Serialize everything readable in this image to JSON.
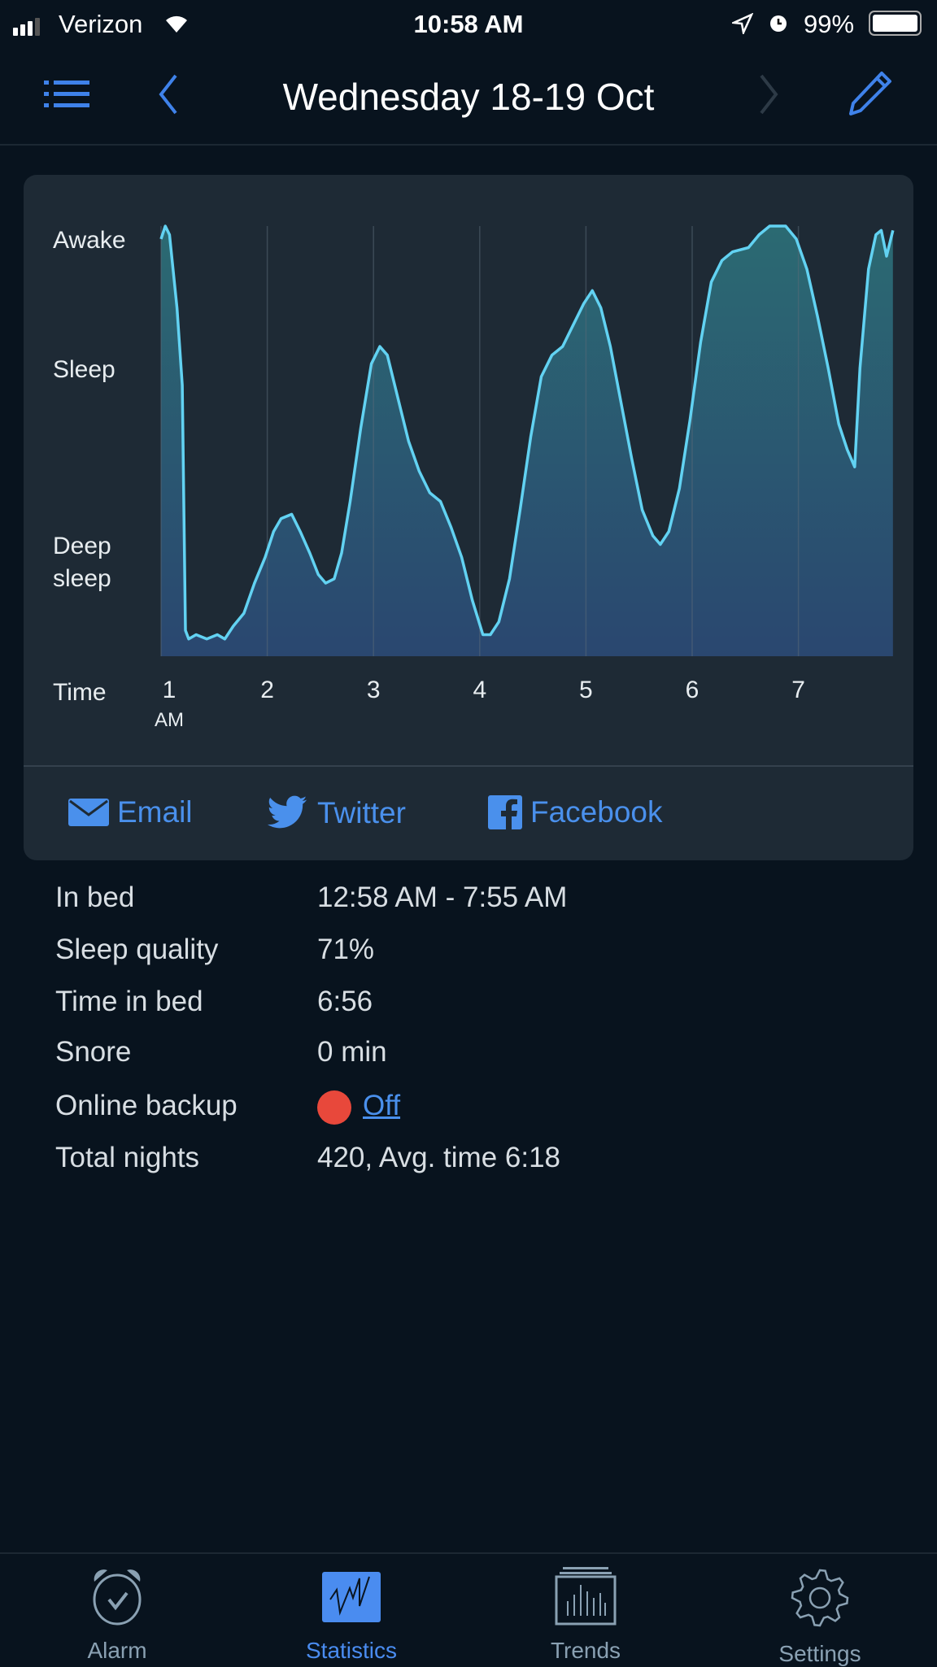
{
  "status_bar": {
    "carrier": "Verizon",
    "time": "10:58 AM",
    "battery": "99%"
  },
  "nav": {
    "title": "Wednesday 18-19 Oct"
  },
  "chart_data": {
    "type": "area",
    "y_categories": [
      "Awake",
      "Sleep",
      "Deep sleep"
    ],
    "xlabel": "Time",
    "x_ticks": [
      "1",
      "2",
      "3",
      "4",
      "5",
      "6",
      "7"
    ],
    "x_tick_sub": "AM",
    "x_range_hours": [
      1.0,
      7.92
    ],
    "y_range": [
      0,
      100
    ],
    "grid": "vertical",
    "colors": {
      "line": "#62d2f2",
      "fill_top": "#2b6a72",
      "fill_bottom": "#2a4770"
    },
    "points": [
      [
        1.0,
        97
      ],
      [
        1.04,
        100
      ],
      [
        1.08,
        98
      ],
      [
        1.15,
        81
      ],
      [
        1.2,
        63
      ],
      [
        1.23,
        6
      ],
      [
        1.26,
        4
      ],
      [
        1.33,
        5
      ],
      [
        1.43,
        4
      ],
      [
        1.53,
        5
      ],
      [
        1.6,
        4
      ],
      [
        1.68,
        7
      ],
      [
        1.78,
        10
      ],
      [
        1.88,
        17
      ],
      [
        1.98,
        23
      ],
      [
        2.06,
        29
      ],
      [
        2.13,
        32
      ],
      [
        2.23,
        33
      ],
      [
        2.31,
        29
      ],
      [
        2.4,
        24
      ],
      [
        2.48,
        19
      ],
      [
        2.55,
        17
      ],
      [
        2.63,
        18
      ],
      [
        2.7,
        24
      ],
      [
        2.78,
        36
      ],
      [
        2.88,
        53
      ],
      [
        2.98,
        68
      ],
      [
        3.06,
        72
      ],
      [
        3.13,
        70
      ],
      [
        3.23,
        60
      ],
      [
        3.33,
        50
      ],
      [
        3.43,
        43
      ],
      [
        3.53,
        38
      ],
      [
        3.63,
        36
      ],
      [
        3.73,
        30
      ],
      [
        3.83,
        23
      ],
      [
        3.93,
        13
      ],
      [
        4.03,
        5
      ],
      [
        4.1,
        5
      ],
      [
        4.18,
        8
      ],
      [
        4.28,
        18
      ],
      [
        4.38,
        34
      ],
      [
        4.48,
        51
      ],
      [
        4.58,
        65
      ],
      [
        4.68,
        70
      ],
      [
        4.78,
        72
      ],
      [
        4.88,
        77
      ],
      [
        4.98,
        82
      ],
      [
        5.06,
        85
      ],
      [
        5.14,
        81
      ],
      [
        5.23,
        72
      ],
      [
        5.33,
        59
      ],
      [
        5.43,
        46
      ],
      [
        5.53,
        34
      ],
      [
        5.63,
        28
      ],
      [
        5.7,
        26
      ],
      [
        5.78,
        29
      ],
      [
        5.88,
        39
      ],
      [
        5.98,
        55
      ],
      [
        6.08,
        73
      ],
      [
        6.18,
        87
      ],
      [
        6.28,
        92
      ],
      [
        6.38,
        94
      ],
      [
        6.53,
        95
      ],
      [
        6.63,
        98
      ],
      [
        6.73,
        100
      ],
      [
        6.88,
        100
      ],
      [
        6.98,
        97
      ],
      [
        7.08,
        90
      ],
      [
        7.18,
        79
      ],
      [
        7.28,
        67
      ],
      [
        7.38,
        54
      ],
      [
        7.46,
        48
      ],
      [
        7.53,
        44
      ],
      [
        7.58,
        67
      ],
      [
        7.66,
        90
      ],
      [
        7.73,
        98
      ],
      [
        7.78,
        99
      ],
      [
        7.83,
        93
      ],
      [
        7.89,
        99
      ]
    ]
  },
  "share": {
    "email": "Email",
    "twitter": "Twitter",
    "facebook": "Facebook"
  },
  "stats": [
    {
      "label": "In bed",
      "value": "12:58 AM - 7:55 AM"
    },
    {
      "label": "Sleep quality",
      "value": "71%"
    },
    {
      "label": "Time in bed",
      "value": "6:56"
    },
    {
      "label": "Snore",
      "value": "0 min"
    },
    {
      "label": "Online backup",
      "value": "Off",
      "status_color": "#e8483b"
    },
    {
      "label": "Total nights",
      "value": "420, Avg. time 6:18"
    }
  ],
  "tabs": [
    {
      "label": "Alarm"
    },
    {
      "label": "Statistics",
      "active": true
    },
    {
      "label": "Trends"
    },
    {
      "label": "Settings"
    }
  ],
  "accent": "#3f82ea"
}
